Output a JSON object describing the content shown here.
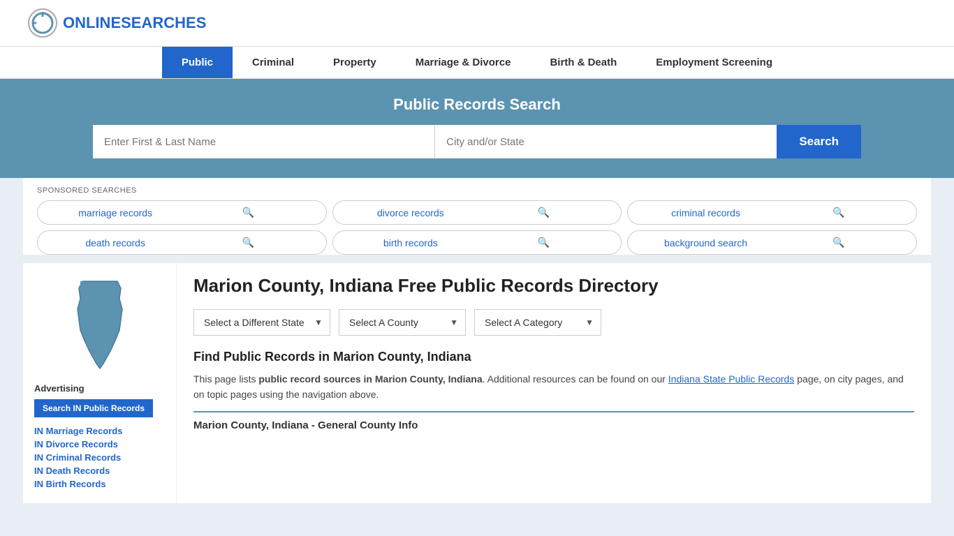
{
  "header": {
    "logo_text_normal": "ONLINE",
    "logo_text_colored": "SEARCHES"
  },
  "nav": {
    "items": [
      {
        "label": "Public",
        "active": true
      },
      {
        "label": "Criminal",
        "active": false
      },
      {
        "label": "Property",
        "active": false
      },
      {
        "label": "Marriage & Divorce",
        "active": false
      },
      {
        "label": "Birth & Death",
        "active": false
      },
      {
        "label": "Employment Screening",
        "active": false
      }
    ]
  },
  "search_banner": {
    "title": "Public Records Search",
    "name_placeholder": "Enter First & Last Name",
    "location_placeholder": "City and/or State",
    "button_label": "Search"
  },
  "sponsored": {
    "label": "SPONSORED SEARCHES",
    "items": [
      {
        "label": "marriage records"
      },
      {
        "label": "divorce records"
      },
      {
        "label": "criminal records"
      },
      {
        "label": "death records"
      },
      {
        "label": "birth records"
      },
      {
        "label": "background search"
      }
    ]
  },
  "sidebar": {
    "advertising_label": "Advertising",
    "search_btn_label": "Search IN Public Records",
    "links": [
      {
        "label": "IN Marriage Records"
      },
      {
        "label": "IN Divorce Records"
      },
      {
        "label": "IN Criminal Records"
      },
      {
        "label": "IN Death Records"
      },
      {
        "label": "IN Birth Records"
      }
    ]
  },
  "main": {
    "page_title": "Marion County, Indiana Free Public Records Directory",
    "dropdowns": {
      "state": {
        "label": "Select a Different State"
      },
      "county": {
        "label": "Select A County"
      },
      "category": {
        "label": "Select A Category"
      }
    },
    "find_title": "Find Public Records in Marion County, Indiana",
    "desc_part1": "This page lists ",
    "desc_bold": "public record sources in Marion County, Indiana",
    "desc_part2": ". Additional resources can be found on our ",
    "desc_link": "Indiana State Public Records",
    "desc_part3": " page, on city pages, and on topic pages using the navigation above.",
    "county_info_title": "Marion County, Indiana - General County Info"
  }
}
